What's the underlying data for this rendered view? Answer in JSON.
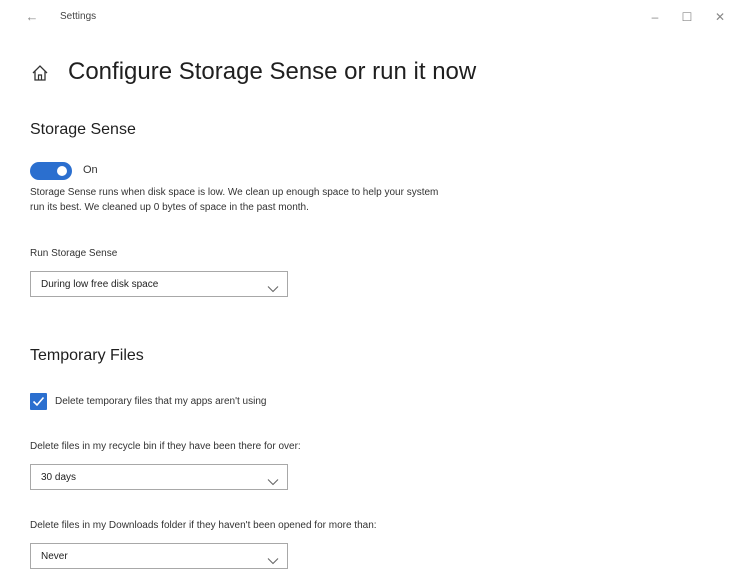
{
  "titlebar": {
    "app_title": "Settings",
    "back_glyph": "←",
    "minimize_glyph": "–",
    "maximize_glyph": "☐",
    "close_glyph": "✕"
  },
  "header": {
    "icon": "home-icon",
    "title": "Configure Storage Sense or run it now"
  },
  "storage_sense": {
    "section_title": "Storage Sense",
    "toggle_state": "On",
    "description": "Storage Sense runs when disk space is low. We clean up enough space to help your system run its best. We cleaned up 0 bytes of space in the past month.",
    "run_label": "Run Storage Sense",
    "run_value": "During low free disk space"
  },
  "temporary_files": {
    "section_title": "Temporary Files",
    "delete_temp_label": "Delete temporary files that my apps aren't using",
    "delete_temp_checked": true,
    "recycle_label": "Delete files in my recycle bin if they have been there for over:",
    "recycle_value": "30 days",
    "downloads_label": "Delete files in my Downloads folder if they haven't been opened for more than:",
    "downloads_value": "Never"
  },
  "colors": {
    "accent": "#2b6fcf"
  }
}
